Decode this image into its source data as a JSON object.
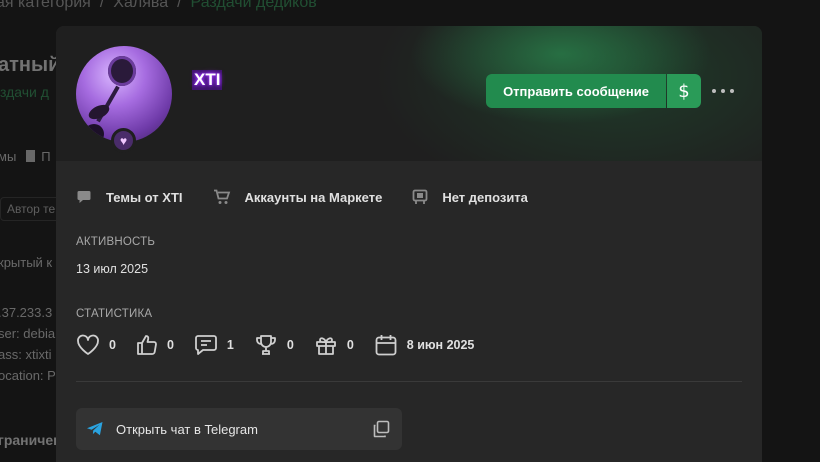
{
  "background": {
    "breadcrumb": [
      "ая категория",
      "Халява",
      "Раздачи дедиков"
    ],
    "title": "атный",
    "subtitle": "здачи д",
    "meta": [
      "мы",
      "П"
    ],
    "tag": "Автор те",
    "lines": [
      "крытый к",
      ".37.233.3",
      "ser: debia",
      "ass: xtixti",
      "ocation: P"
    ],
    "bottom": "граничен"
  },
  "profile": {
    "username": "XTI",
    "send_message_label": "Отправить сообщение",
    "dollar_label": "$"
  },
  "links": [
    {
      "label": "Темы от XTI",
      "icon": "chat-bubble-icon"
    },
    {
      "label": "Аккаунты на Маркете",
      "icon": "cart-icon"
    },
    {
      "label": "Нет депозита",
      "icon": "deposit-icon"
    }
  ],
  "activity": {
    "label": "АКТИВНОСТЬ",
    "date": "13 июл 2025"
  },
  "stats": {
    "label": "СТАТИСТИКА",
    "likes": "0",
    "thumbs": "0",
    "messages": "1",
    "trophies": "0",
    "gifts": "0",
    "registered": "8 июн 2025"
  },
  "telegram": {
    "label": "Открыть чат в Telegram"
  },
  "colors": {
    "accent": "#228b4e",
    "username_glow": "#9b30ff",
    "telegram": "#2aa3e0"
  }
}
